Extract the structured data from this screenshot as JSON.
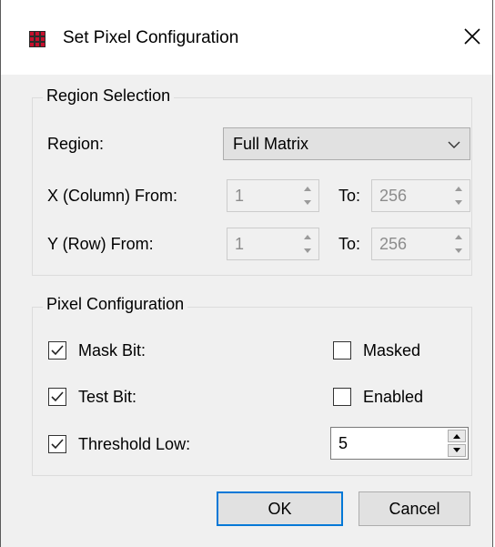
{
  "window": {
    "title": "Set Pixel Configuration",
    "app_icon": "matrix-grid-icon",
    "close_icon": "close-icon"
  },
  "region_selection": {
    "group_label": "Region Selection",
    "region_label": "Region:",
    "region_value": "Full Matrix",
    "x_from_label": "X (Column) From:",
    "x_from_value": "1",
    "x_to_label": "To:",
    "x_to_value": "256",
    "y_from_label": "Y (Row) From:",
    "y_from_value": "1",
    "y_to_label": "To:",
    "y_to_value": "256"
  },
  "pixel_configuration": {
    "group_label": "Pixel Configuration",
    "mask_bit_label": "Mask Bit:",
    "mask_bit_checked": true,
    "masked_label": "Masked",
    "masked_checked": false,
    "test_bit_label": "Test Bit:",
    "test_bit_checked": true,
    "enabled_label": "Enabled",
    "enabled_checked": false,
    "threshold_low_label": "Threshold Low:",
    "threshold_low_checked": true,
    "threshold_low_value": "5"
  },
  "buttons": {
    "ok": "OK",
    "cancel": "Cancel"
  },
  "colors": {
    "accent": "#0078d7",
    "icon_red": "#c8102e"
  }
}
